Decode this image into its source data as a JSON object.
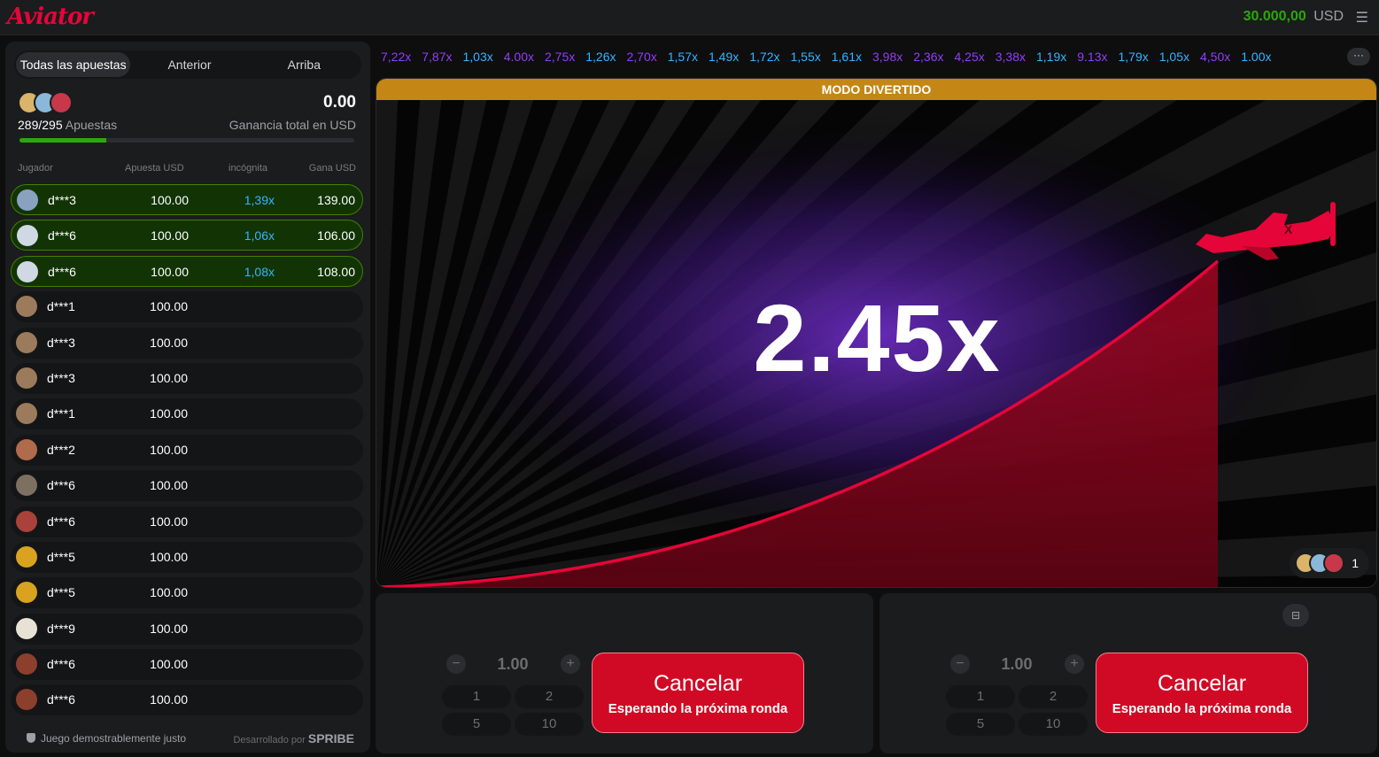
{
  "header": {
    "logo": "Aviator",
    "balance": "30.000,00",
    "currency": "USD",
    "menu_icon": "hamburger-icon"
  },
  "left": {
    "tabs": [
      {
        "label": "Todas las apuestas",
        "active": true
      },
      {
        "label": "Anterior",
        "active": false
      },
      {
        "label": "Arriba",
        "active": false
      }
    ],
    "bets_count": "289/295",
    "bets_label": "Apuestas",
    "progress": 0.26,
    "total_win": "0.00",
    "total_win_label": "Ganancia total en USD",
    "columns": [
      "Jugador",
      "Apuesta USD",
      "incógnita",
      "Gana USD"
    ],
    "rows": [
      {
        "player": "d***3",
        "bet": "100.00",
        "mult": "1,39x",
        "win": "139.00",
        "won": true,
        "color": "#8aa2c0"
      },
      {
        "player": "d***6",
        "bet": "100.00",
        "mult": "1,06x",
        "win": "106.00",
        "won": true,
        "color": "#cfd8e3"
      },
      {
        "player": "d***6",
        "bet": "100.00",
        "mult": "1,08x",
        "win": "108.00",
        "won": true,
        "color": "#cfd8e3"
      },
      {
        "player": "d***1",
        "bet": "100.00",
        "mult": "",
        "win": "",
        "won": false,
        "color": "#9b7b5c"
      },
      {
        "player": "d***3",
        "bet": "100.00",
        "mult": "",
        "win": "",
        "won": false,
        "color": "#9b7b5c"
      },
      {
        "player": "d***3",
        "bet": "100.00",
        "mult": "",
        "win": "",
        "won": false,
        "color": "#9b7b5c"
      },
      {
        "player": "d***1",
        "bet": "100.00",
        "mult": "",
        "win": "",
        "won": false,
        "color": "#9b7b5c"
      },
      {
        "player": "d***2",
        "bet": "100.00",
        "mult": "",
        "win": "",
        "won": false,
        "color": "#b06a4c"
      },
      {
        "player": "d***6",
        "bet": "100.00",
        "mult": "",
        "win": "",
        "won": false,
        "color": "#7d7060"
      },
      {
        "player": "d***6",
        "bet": "100.00",
        "mult": "",
        "win": "",
        "won": false,
        "color": "#a8423a"
      },
      {
        "player": "d***5",
        "bet": "100.00",
        "mult": "",
        "win": "",
        "won": false,
        "color": "#d9a320"
      },
      {
        "player": "d***5",
        "bet": "100.00",
        "mult": "",
        "win": "",
        "won": false,
        "color": "#d9a320"
      },
      {
        "player": "d***9",
        "bet": "100.00",
        "mult": "",
        "win": "",
        "won": false,
        "color": "#e8e2d6"
      },
      {
        "player": "d***6",
        "bet": "100.00",
        "mult": "",
        "win": "",
        "won": false,
        "color": "#8c3f2c"
      },
      {
        "player": "d***6",
        "bet": "100.00",
        "mult": "",
        "win": "",
        "won": false,
        "color": "#8c3f2c"
      }
    ],
    "footer_left": "Juego demostrablemente justo",
    "footer_right_prefix": "Desarrollado por",
    "footer_right_brand": "SPRIBE"
  },
  "history": [
    {
      "v": "7,22x",
      "c": "#913ef8"
    },
    {
      "v": "7,87x",
      "c": "#913ef8"
    },
    {
      "v": "1,03x",
      "c": "#34b4ff"
    },
    {
      "v": "4.00x",
      "c": "#913ef8"
    },
    {
      "v": "2,75x",
      "c": "#913ef8"
    },
    {
      "v": "1,26x",
      "c": "#34b4ff"
    },
    {
      "v": "2,70x",
      "c": "#913ef8"
    },
    {
      "v": "1,57x",
      "c": "#34b4ff"
    },
    {
      "v": "1,49x",
      "c": "#34b4ff"
    },
    {
      "v": "1,72x",
      "c": "#34b4ff"
    },
    {
      "v": "1,55x",
      "c": "#34b4ff"
    },
    {
      "v": "1,61x",
      "c": "#34b4ff"
    },
    {
      "v": "3,98x",
      "c": "#913ef8"
    },
    {
      "v": "2,36x",
      "c": "#913ef8"
    },
    {
      "v": "4,25x",
      "c": "#913ef8"
    },
    {
      "v": "3,38x",
      "c": "#913ef8"
    },
    {
      "v": "1,19x",
      "c": "#34b4ff"
    },
    {
      "v": "9.13x",
      "c": "#913ef8"
    },
    {
      "v": "1,79x",
      "c": "#34b4ff"
    },
    {
      "v": "1,05x",
      "c": "#34b4ff"
    },
    {
      "v": "4,50x",
      "c": "#913ef8"
    },
    {
      "v": "1.00x",
      "c": "#34b4ff"
    }
  ],
  "history_more": "···",
  "game": {
    "banner": "MODO DIVERTIDO",
    "multiplier": "2.45x",
    "players_count": "1",
    "curve_color": "#e50539"
  },
  "bet_panels": [
    {
      "stake": "1.00",
      "minus": "−",
      "plus": "+",
      "quick": [
        "1",
        "2",
        "5",
        "10"
      ],
      "cancel": "Cancelar",
      "waiting": "Esperando la próxima ronda"
    },
    {
      "stake": "1.00",
      "minus": "−",
      "plus": "+",
      "quick": [
        "1",
        "2",
        "5",
        "10"
      ],
      "cancel": "Cancelar",
      "waiting": "Esperando la próxima ronda"
    }
  ]
}
